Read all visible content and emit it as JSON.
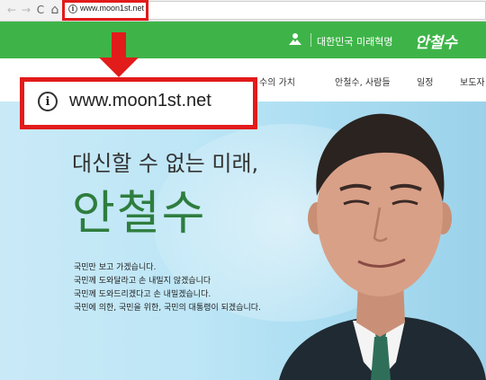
{
  "browser": {
    "back_icon": "←",
    "forward_icon": "→",
    "reload_icon": "C",
    "home_icon": "⌂",
    "info_icon": "i",
    "url": "www.moon1st.net"
  },
  "header": {
    "slogan": "대한민국 미래혁명",
    "brand": "안철수",
    "color": "#3eb448"
  },
  "menu": {
    "items": [
      {
        "label": "수의 가치"
      },
      {
        "label": "안철수, 사람들"
      },
      {
        "label": "일정"
      },
      {
        "label": "보도자"
      }
    ]
  },
  "hero": {
    "headline": "대신할 수 없는 미래,",
    "name": "안철수",
    "promises": [
      "국민만 보고 가겠습니다.",
      "국민께 도와달라고 손 내밀지 않겠습니다",
      "국민께 도와드리겠다고 손 내밀겠습니다.",
      "국민에 의한, 국민을 위한, 국민의 대통령이 되겠습니다."
    ]
  },
  "callout": {
    "info_icon": "i",
    "url": "www.moon1st.net",
    "color": "#e21b1b"
  }
}
